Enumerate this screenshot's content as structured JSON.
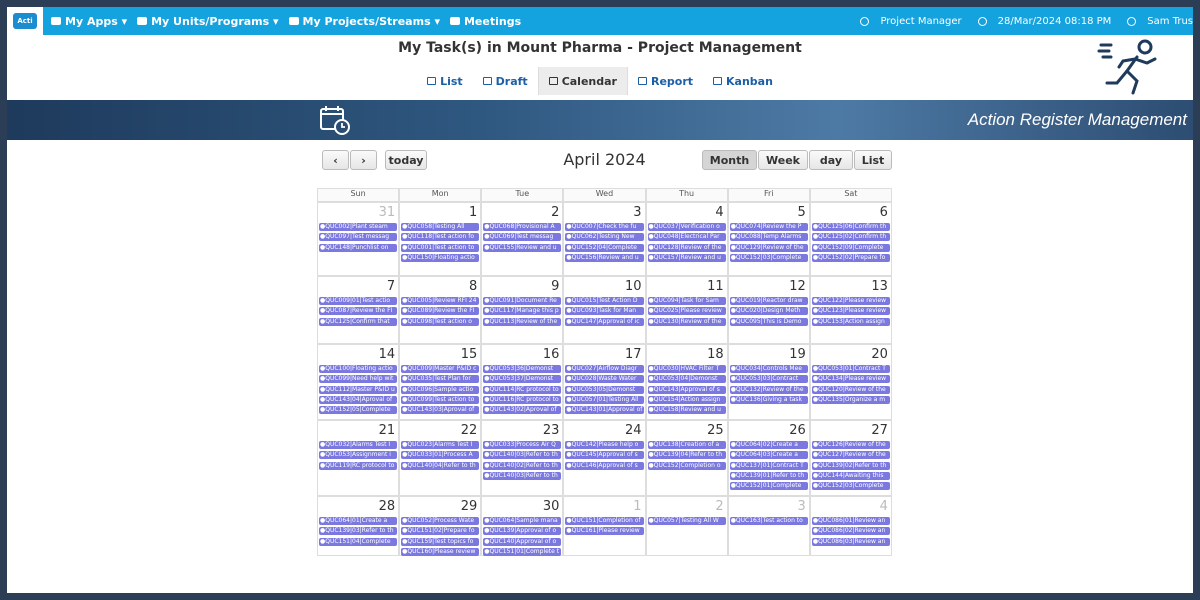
{
  "nav": {
    "items": [
      "My Apps ▾",
      "My Units/Programs ▾",
      "My Projects/Streams ▾",
      "Meetings"
    ],
    "role": "Project Manager",
    "datetime": "28/Mar/2024 08:18 PM",
    "user": "Sam Trus"
  },
  "page_title": "My Task(s) in Mount Pharma - Project Management",
  "tabs": [
    "List",
    "Draft",
    "Calendar",
    "Report",
    "Kanban"
  ],
  "banner_title": "Action Register Management",
  "calendar": {
    "prev": "‹",
    "next": "›",
    "today": "today",
    "title": "April 2024",
    "views": [
      "Month",
      "Week",
      "day",
      "List"
    ],
    "dow": [
      "Sun",
      "Mon",
      "Tue",
      "Wed",
      "Thu",
      "Fri",
      "Sat"
    ],
    "weeks": [
      {
        "days": [
          {
            "n": "31",
            "o": true,
            "e": [
              "QUC002|Plant steam",
              "QUC097|Test messag",
              "QUC148|Punchlist on"
            ]
          },
          {
            "n": "1",
            "e": [
              "QUC058|Testing All",
              "QUC118|Test action fo",
              "QUC001|Test action to",
              "QUC150|Floating actio"
            ]
          },
          {
            "n": "2",
            "e": [
              "QUC068|Provisional A",
              "QUC069|Test messag",
              "QUC155|Review and u"
            ]
          },
          {
            "n": "3",
            "e": [
              "QUC007|Check the fu",
              "QUC062|Testing New",
              "QUC152|04|Complete",
              "QUC156|Review and u"
            ]
          },
          {
            "n": "4",
            "e": [
              "QUC037|Verification o",
              "QUC048|Electrical Par",
              "QUC128|Review of the",
              "QUC157|Review and u"
            ]
          },
          {
            "n": "5",
            "e": [
              "QUC074|Review the P",
              "QUC088|Temp Alarms",
              "QUC129|Review of the",
              "QUC152|03|Complete"
            ]
          },
          {
            "n": "6",
            "e": [
              "QUC125|06|Confirm th",
              "QUC125|02|Confirm th",
              "QUC152|09|Complete",
              "QUC152|02|Prepare fo"
            ]
          }
        ]
      },
      {
        "days": [
          {
            "n": "7",
            "e": [
              "QUC009|01|Test actio",
              "QUC087|Review the FI",
              "QUC125|Confirm that"
            ]
          },
          {
            "n": "8",
            "e": [
              "QUC005|Review RFI 24",
              "QUC089|Review the FI",
              "QUC098|Test action o"
            ]
          },
          {
            "n": "9",
            "e": [
              "QUC091|Document Re",
              "QUC117|Manage this p",
              "QUC113|Review of the"
            ]
          },
          {
            "n": "10",
            "e": [
              "QUC015|Test Action D",
              "QUC093|Task for Man",
              "QUC147|Approval of ic"
            ]
          },
          {
            "n": "11",
            "e": [
              "QUC094|Task for Sam",
              "QUC025|Please review",
              "QUC130|Review of the"
            ]
          },
          {
            "n": "12",
            "e": [
              "QUC019|Reactor draw",
              "QUC020|Design Meth",
              "QUC095|This is Demo"
            ]
          },
          {
            "n": "13",
            "e": [
              "QUC122|Please review",
              "QUC123|Please review",
              "QUC153|Action assign"
            ]
          }
        ]
      },
      {
        "days": [
          {
            "n": "14",
            "e": [
              "QUC100|Floating actio",
              "QUC099|Need help wit",
              "QUC112|Master P&ID u",
              "QUC143|04|Aproval of",
              "QUC152|05|Complete"
            ]
          },
          {
            "n": "15",
            "e": [
              "QUC009|Master P&ID c",
              "QUC035|Test Plan for",
              "QUC096|Sample actio",
              "QUC099|Test action to",
              "QUC143|03|Aproval of"
            ]
          },
          {
            "n": "16",
            "e": [
              "QUC053|36|Demonst",
              "QUC053|37|Demonst",
              "QUC114|RC protocol to",
              "QUC116|RC protocol to",
              "QUC143|02|Aproval of"
            ]
          },
          {
            "n": "17",
            "e": [
              "QUC027|Airflow Diagr",
              "QUC028|Waste Water",
              "QUC053|05|Demonst",
              "QUC057|01|Testing All",
              "QUC143|01|Approval of"
            ]
          },
          {
            "n": "18",
            "e": [
              "QUC030|HVAC Filter T",
              "QUC053|04|Demonst",
              "QUC143|Approval of s",
              "QUC154|Action assign",
              "QUC158|Review and u"
            ]
          },
          {
            "n": "19",
            "e": [
              "QUC034|Controls Mee",
              "QUC053|03|Contract",
              "QUC132|Review of the",
              "QUC136|Giving a task"
            ]
          },
          {
            "n": "20",
            "e": [
              "QUC053|01|Contract T",
              "QUC134|Please review",
              "QUC120|Review of the",
              "QUC135|Organize a m"
            ]
          }
        ]
      },
      {
        "days": [
          {
            "n": "21",
            "e": [
              "QUC032|Alarms Test I",
              "QUC053|Assignment i",
              "QUC119|RC protocol to"
            ]
          },
          {
            "n": "22",
            "e": [
              "QUC023|Alarms Test I",
              "QUC033|01|Process A",
              "QUC140|04|Refer to th"
            ]
          },
          {
            "n": "23",
            "e": [
              "QUC033|Process Air Q",
              "QUC140|03|Refer to th",
              "QUC140|02|Refer to th",
              "QUC140|03|Refer to th"
            ]
          },
          {
            "n": "24",
            "e": [
              "QUC142|Please help o",
              "QUC145|Approval of s",
              "QUC146|Approval of s"
            ]
          },
          {
            "n": "25",
            "e": [
              "QUC138|Creation of a",
              "QUC139|04|Refer to th",
              "QUC152|Completion o"
            ]
          },
          {
            "n": "26",
            "e": [
              "QUC064|02|Create a",
              "QUC064|03|Create a",
              "QUC137|01|Contract T",
              "QUC139|01|Refer to th",
              "QUC152|01|Complete"
            ]
          },
          {
            "n": "27",
            "e": [
              "QUC126|Review of the",
              "QUC127|Review of the",
              "QUC139|02|Refer to th",
              "QUC144|Awaiting this",
              "QUC152|03|Complete"
            ]
          }
        ]
      },
      {
        "days": [
          {
            "n": "28",
            "e": [
              "QUC064|01|Create a",
              "QUC139|03|Refer to th",
              "QUC151|04|Complete"
            ]
          },
          {
            "n": "29",
            "e": [
              "QUC052|Process Wate",
              "QUC151|02|Prepare fo",
              "QUC159|Test topics fo",
              "QUC160|Please review"
            ]
          },
          {
            "n": "30",
            "e": [
              "QUC064|Sample mana",
              "QUC139|Approval of o",
              "QUC140|Approval of o",
              "QUC151|01|Complete t"
            ]
          },
          {
            "n": "1",
            "o": true,
            "e": [
              "QUC151|Completion of",
              "QUC161|Please review"
            ]
          },
          {
            "n": "2",
            "o": true,
            "e": [
              "QUC057|Testing All W"
            ]
          },
          {
            "n": "3",
            "o": true,
            "e": [
              "QUC163|Test action to"
            ]
          },
          {
            "n": "4",
            "o": true,
            "e": [
              "QUC086|01|Review an",
              "QUC086|02|Review an",
              "QUC086|03|Review an"
            ]
          }
        ]
      }
    ]
  },
  "colors": {
    "nav": "#15a3e0",
    "event": "#7b79e0",
    "border": "#2c3e55"
  }
}
